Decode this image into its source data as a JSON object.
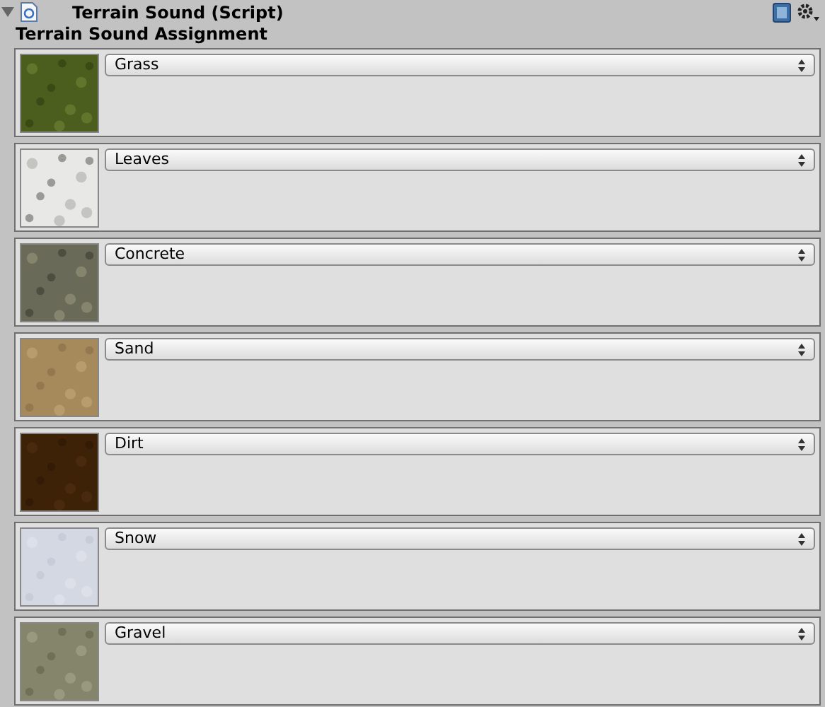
{
  "component": {
    "title": "Terrain Sound (Script)",
    "expanded": true
  },
  "section": {
    "title": "Terrain Sound Assignment"
  },
  "rows": [
    {
      "sound": "Grass"
    },
    {
      "sound": "Leaves"
    },
    {
      "sound": "Concrete"
    },
    {
      "sound": "Sand"
    },
    {
      "sound": "Dirt"
    },
    {
      "sound": "Snow"
    },
    {
      "sound": "Gravel"
    }
  ]
}
